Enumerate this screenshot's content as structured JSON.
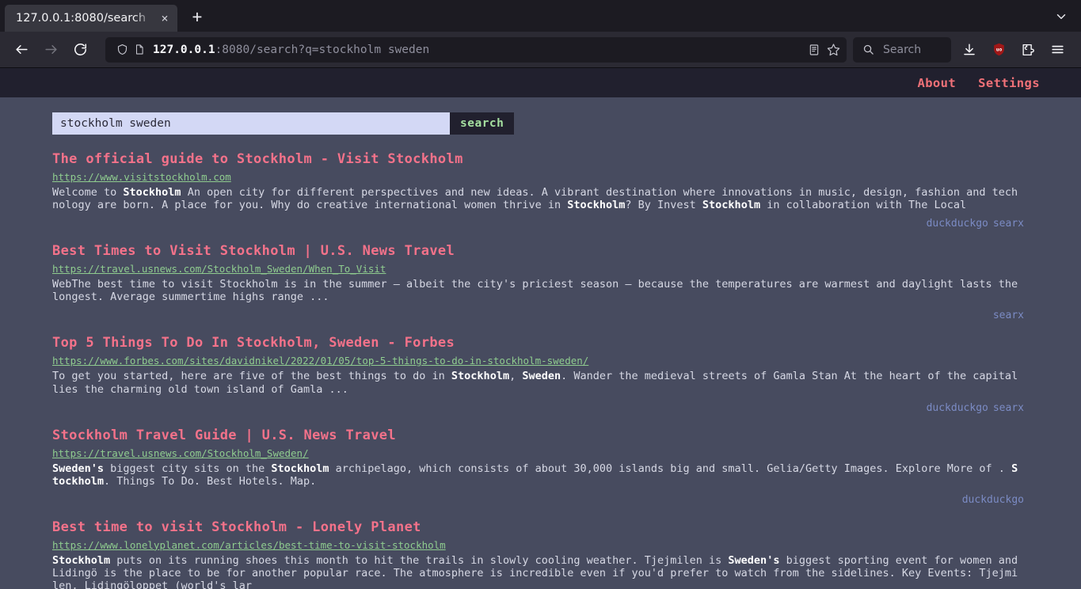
{
  "browser": {
    "tab": {
      "title": "127.0.0.1:8080/search",
      "close_label": "×"
    },
    "new_tab_label": "+",
    "tab_list_icon": "chevron-down-icon",
    "nav": {
      "back_icon": "back-arrow-icon",
      "forward_icon": "forward-arrow-icon",
      "reload_icon": "reload-icon"
    },
    "urlbar": {
      "shield_icon": "shield-icon",
      "page_icon": "page-icon",
      "host": "127.0.0.1",
      "rest": ":8080/search?q=stockholm sweden",
      "reader_icon": "reader-view-icon",
      "bookmark_icon": "star-icon"
    },
    "search": {
      "placeholder": "Search",
      "icon": "search-icon"
    },
    "toolbar": {
      "downloads_icon": "download-icon",
      "ublock_icon": "ublock-shield-icon",
      "ublock_label": "uo",
      "extensions_icon": "extension-icon",
      "menu_icon": "hamburger-menu-icon"
    }
  },
  "site": {
    "header_links": [
      {
        "label": "About"
      },
      {
        "label": "Settings"
      }
    ],
    "search": {
      "query": "stockholm sweden",
      "placeholder": "stockholm sweden",
      "button_label": "search"
    },
    "results": [
      {
        "title": "The official guide to Stockholm - Visit Stockholm",
        "url": "https://www.visitstockholm.com",
        "content_html": "Welcome to <b>Stockholm</b> An open city for different perspectives and new ideas. A vibrant destination where innovations in music, design, fashion and technology are born. A place for you. Why do creative international women thrive in <b>Stockholm</b>? By Invest <b>Stockholm</b> in collaboration with The Local",
        "engines": [
          "duckduckgo",
          "searx"
        ]
      },
      {
        "title": "Best Times to Visit Stockholm | U.S. News Travel",
        "url": "https://travel.usnews.com/Stockholm_Sweden/When_To_Visit",
        "content_html": "WebThe best time to visit Stockholm is in the summer – albeit the city's priciest season – because the temperatures are warmest and daylight lasts the longest. Average summertime highs range ...",
        "engines": [
          "searx"
        ]
      },
      {
        "title": "Top 5 Things To Do In Stockholm, Sweden - Forbes",
        "url": "https://www.forbes.com/sites/davidnikel/2022/01/05/top-5-things-to-do-in-stockholm-sweden/",
        "content_html": "To get you started, here are five of the best things to do in <b>Stockholm</b>, <b>Sweden</b>. Wander the medieval streets of Gamla Stan At the heart of the capital lies the charming old town island of Gamla ...",
        "engines": [
          "duckduckgo",
          "searx"
        ]
      },
      {
        "title": "Stockholm Travel Guide | U.S. News Travel",
        "url": "https://travel.usnews.com/Stockholm_Sweden/",
        "content_html": "<b>Sweden's</b> biggest city sits on the <b>Stockholm</b> archipelago, which consists of about 30,000 islands big and small. Gelia/Getty Images. Explore More of . <b>Stockholm</b>. Things To Do. Best Hotels. Map.",
        "engines": [
          "duckduckgo"
        ]
      },
      {
        "title": "Best time to visit Stockholm - Lonely Planet",
        "url": "https://www.lonelyplanet.com/articles/best-time-to-visit-stockholm",
        "content_html": "<b>Stockholm</b> puts on its running shoes this month to hit the trails in slowly cooling weather. Tjejmilen is <b>Sweden's</b> biggest sporting event for women and Lidingö is the place to be for another popular race. The atmosphere is incredible even if you'd prefer to watch from the sidelines. Key Events: Tjejmilen, Lidingöloppet (world's lar",
        "engines": []
      }
    ]
  },
  "colors": {
    "page_bg": "#474b5f",
    "header_bg": "#21202e",
    "title_link": "#f4728a",
    "url_green": "#8fcc8f",
    "engine_blue": "#7b8bc4",
    "search_btn_text": "#a5e0a0",
    "input_bg": "#d3d8f5"
  }
}
